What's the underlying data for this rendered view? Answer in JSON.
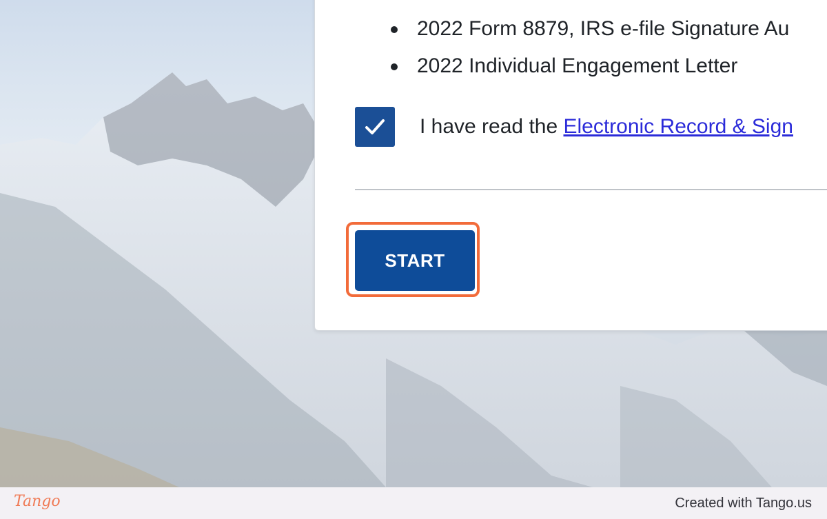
{
  "documents": [
    "2022 Form 8879, IRS e-file Signature Au",
    "2022 Individual Engagement Letter"
  ],
  "consent": {
    "checked": true,
    "prefix": "I have read the ",
    "link_text": "Electronic Record & Sign"
  },
  "start_button": {
    "label": "START"
  },
  "footer": {
    "logo": "Tango",
    "credit": "Created with Tango.us"
  },
  "colors": {
    "button": "#0e4c99",
    "highlight": "#f26b3a",
    "link": "#2b2bd9",
    "checkbox": "#1b4f96"
  }
}
